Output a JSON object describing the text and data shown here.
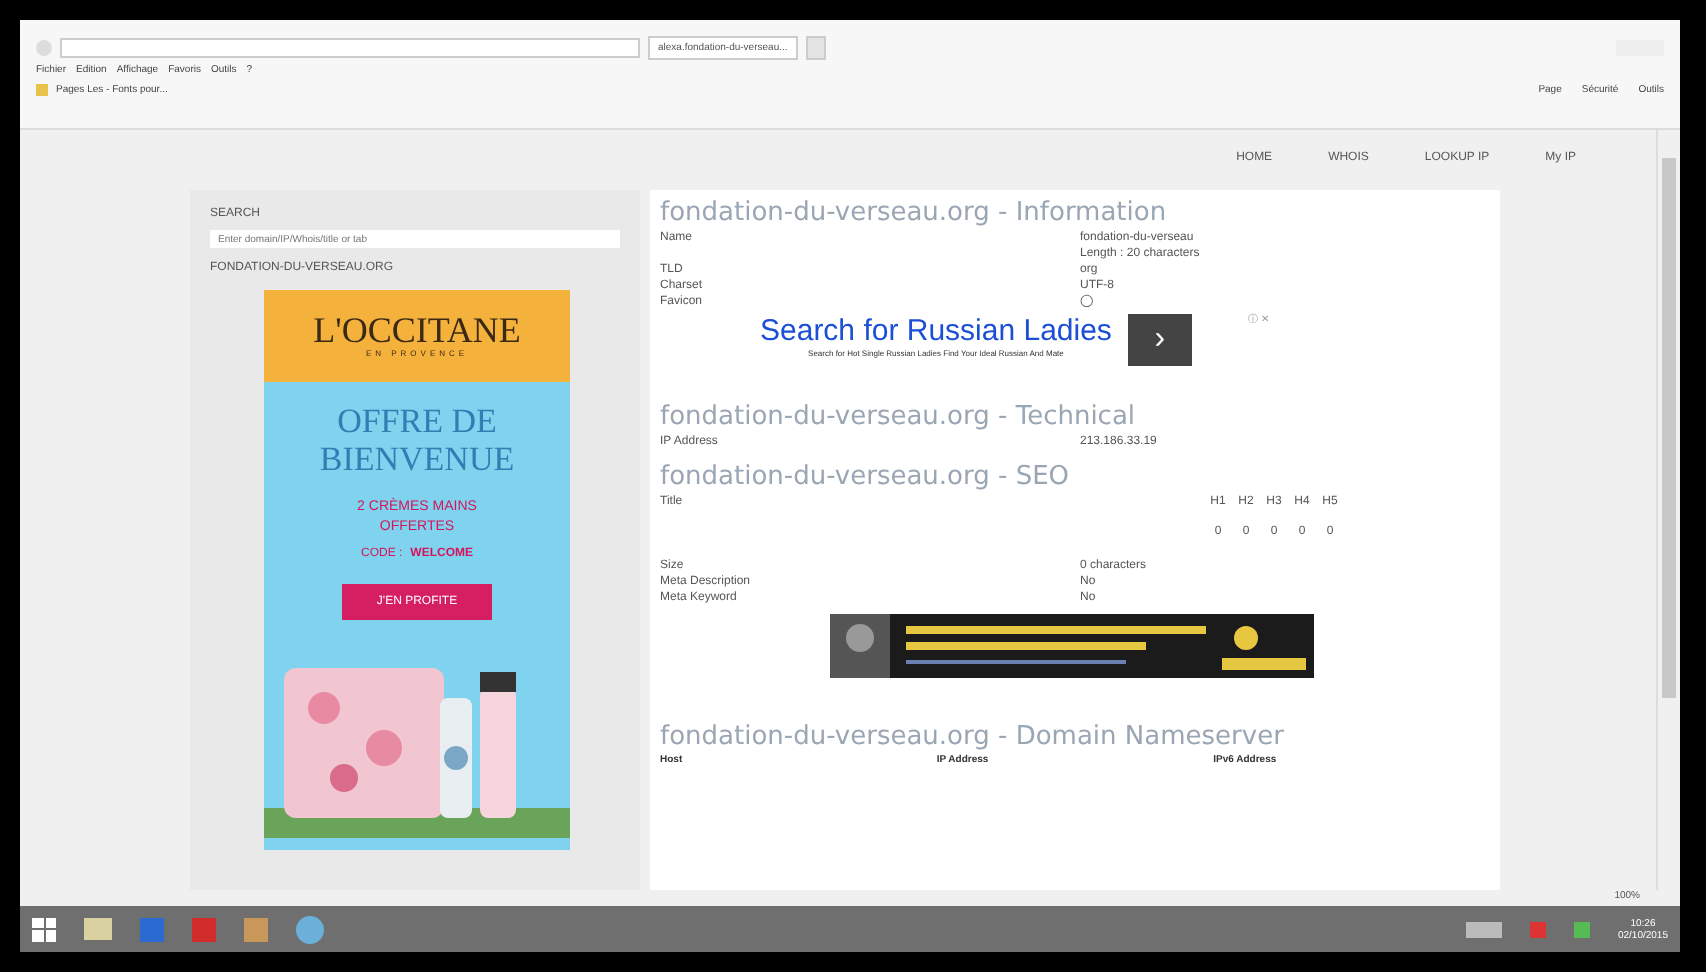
{
  "browser": {
    "tab_title": "alexa.fondation-du-verseau...",
    "menu": [
      "Fichier",
      "Edition",
      "Affichage",
      "Favoris",
      "Outils",
      "?"
    ],
    "favorites_item": "Pages Les - Fonts pour...",
    "toolbar": [
      "Page",
      "Sécurité",
      "Outils"
    ],
    "zoom": "100%"
  },
  "nav": [
    {
      "label": "HOME"
    },
    {
      "label": "WHOIS"
    },
    {
      "label": "LOOKUP IP"
    },
    {
      "label": "My IP"
    }
  ],
  "sidebar": {
    "search_label": "SEARCH",
    "search_placeholder": "Enter domain/IP/Whois/title or tab",
    "domain_heading": "FONDATION-DU-VERSEAU.ORG",
    "ad": {
      "brand": "L'OCCITANE",
      "brand_sub": "EN PROVENCE",
      "headline": "OFFRE DE BIENVENUE",
      "offer": "2 CRÈMES MAINS OFFERTES",
      "code_label": "CODE :",
      "code": "WELCOME",
      "cta": "J'EN PROFITE"
    }
  },
  "information": {
    "title": "fondation-du-verseau.org - Information",
    "rows": [
      {
        "label": "Name",
        "values": [
          "fondation-du-verseau",
          "Length : 20 characters"
        ]
      },
      {
        "label": "TLD",
        "values": [
          "org"
        ]
      },
      {
        "label": "Charset",
        "values": [
          "UTF-8"
        ]
      },
      {
        "label": "Favicon",
        "values": [
          "◯"
        ]
      }
    ]
  },
  "text_ad": {
    "headline": "Search for Russian Ladies",
    "subline": "Search for Hot Single Russian Ladies Find Your Ideal Russian And Mate",
    "arrow": "›",
    "corner": "ⓘ ✕"
  },
  "technical": {
    "title": "fondation-du-verseau.org - Technical",
    "rows": [
      {
        "label": "IP Address",
        "values": [
          "213.186.33.19"
        ]
      }
    ]
  },
  "seo": {
    "title": "fondation-du-verseau.org - SEO",
    "title_label": "Title",
    "headings": [
      "H1",
      "H2",
      "H3",
      "H4",
      "H5"
    ],
    "counts": [
      "0",
      "0",
      "0",
      "0",
      "0"
    ],
    "rows": [
      {
        "label": "Size",
        "values": [
          "0 characters"
        ]
      },
      {
        "label": "Meta Description",
        "values": [
          "No"
        ]
      },
      {
        "label": "Meta Keyword",
        "values": [
          "No"
        ]
      }
    ]
  },
  "nameserver": {
    "title": "fondation-du-verseau.org - Domain Nameserver",
    "columns": [
      "Host",
      "IP Address",
      "IPv6 Address"
    ]
  },
  "taskbar": {
    "time": "10:26",
    "date": "02/10/2015"
  }
}
